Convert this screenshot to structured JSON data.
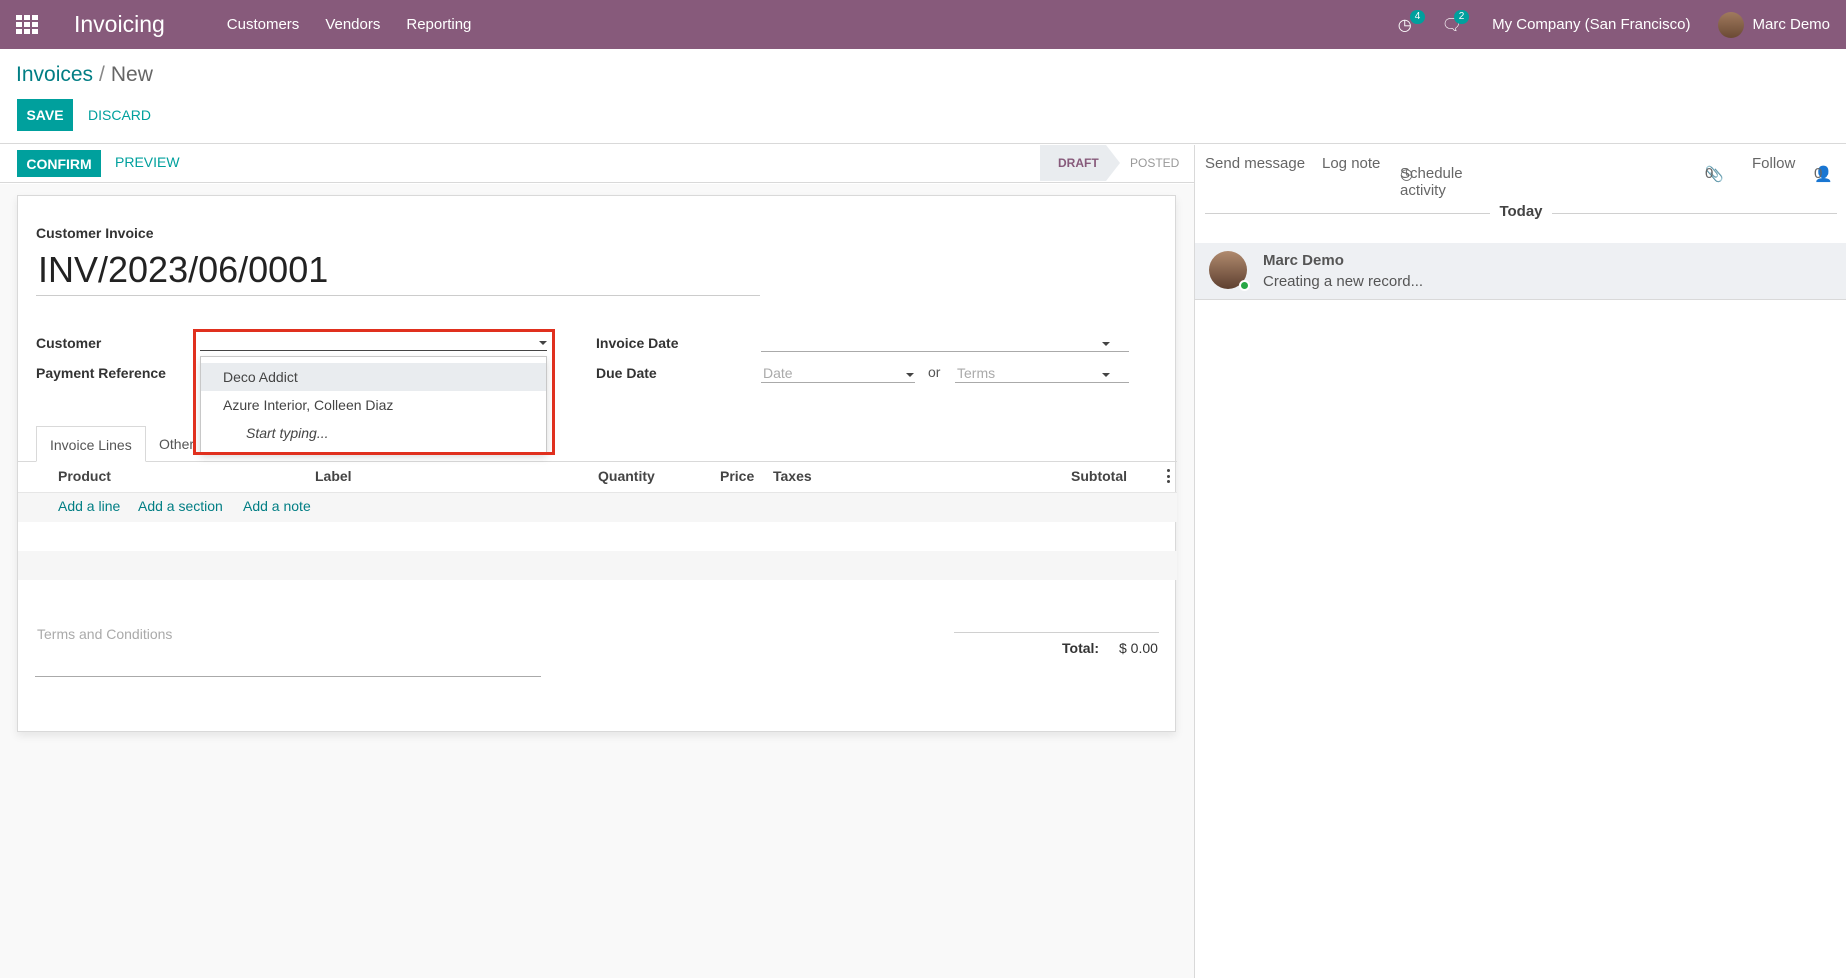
{
  "navbar": {
    "app_name": "Invoicing",
    "menu": [
      "Customers",
      "Vendors",
      "Reporting"
    ],
    "activity_count": "4",
    "message_count": "2",
    "company": "My Company (San Francisco)",
    "user": "Marc Demo"
  },
  "breadcrumb": {
    "parent": "Invoices",
    "separator": "/",
    "current": "New"
  },
  "buttons": {
    "save": "SAVE",
    "discard": "DISCARD",
    "confirm": "CONFIRM",
    "preview": "PREVIEW"
  },
  "status": {
    "draft": "DRAFT",
    "posted": "POSTED"
  },
  "chatter": {
    "send_message": "Send message",
    "log_note": "Log note",
    "schedule_activity": "Schedule activity",
    "attachments": "0",
    "follow": "Follow",
    "followers": "0",
    "day": "Today",
    "message": {
      "author": "Marc Demo",
      "body": "Creating a new record..."
    }
  },
  "form": {
    "type_label": "Customer Invoice",
    "name": "INV/2023/06/0001",
    "customer_label": "Customer",
    "payment_ref_label": "Payment Reference",
    "invoice_date_label": "Invoice Date",
    "due_date_label": "Due Date",
    "date_placeholder": "Date",
    "or_label": "or",
    "terms_placeholder": "Terms",
    "customer_dropdown": [
      "Deco Addict",
      "Azure Interior, Colleen Diaz",
      "Start typing..."
    ]
  },
  "tabs": {
    "invoice_lines": "Invoice Lines",
    "other_info": "Other"
  },
  "lines_table": {
    "columns": [
      "Product",
      "Label",
      "Quantity",
      "Price",
      "Taxes",
      "Subtotal"
    ],
    "add_line": "Add a line",
    "add_section": "Add a section",
    "add_note": "Add a note"
  },
  "footer": {
    "terms_placeholder": "Terms and Conditions",
    "total_label": "Total:",
    "total_value": "$ 0.00"
  },
  "colors": {
    "brand": "#875a7b",
    "accent": "#00a09d",
    "highlight": "#e0301e"
  }
}
